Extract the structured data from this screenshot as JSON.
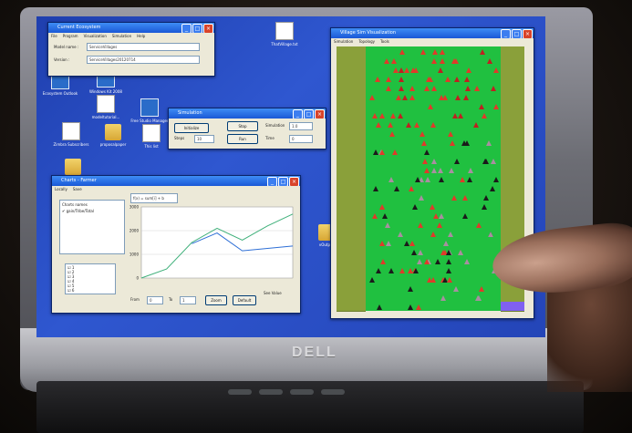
{
  "desktop": {
    "icons": [
      {
        "label": "Ecosystem\nOutlook",
        "kind": "app"
      },
      {
        "label": "Windows\nKit 2008",
        "kind": "app"
      },
      {
        "label": "modeltutorial...",
        "kind": "doc"
      },
      {
        "label": "Free Studio\nManager",
        "kind": "app"
      },
      {
        "label": "Zimbra\nSubscribers",
        "kind": "doc"
      },
      {
        "label": "proposalpaper",
        "kind": "folder"
      },
      {
        "label": "This list",
        "kind": "doc"
      },
      {
        "label": "Ecosystem",
        "kind": "folder"
      },
      {
        "label": "vOutput",
        "kind": "folder"
      },
      {
        "label": "ThatVillage.txt",
        "kind": "doc"
      }
    ]
  },
  "model_window": {
    "title": "Current Ecosystem",
    "menu": [
      "File",
      "Program",
      "Visualization",
      "Simulation",
      "Help"
    ],
    "fields": [
      {
        "label": "Model name :",
        "value": "ServiceVillages"
      },
      {
        "label": "Version :",
        "value": "ServiceVillages20120714"
      }
    ]
  },
  "simulation_window": {
    "title": "Simulation",
    "buttons": {
      "initialize": "Initialize",
      "stop": "Stop",
      "run": "Run"
    },
    "fields": [
      {
        "label": "Steps",
        "value": "10"
      },
      {
        "label": "Simulation",
        "value": "1.0"
      },
      {
        "label": "Time",
        "value": "0"
      }
    ]
  },
  "charts_window": {
    "title": "Charts - Farmer",
    "menu": [
      "Locally",
      "Save"
    ],
    "formula": "f(x) = sum[i] + b",
    "charts_label": "Charts names",
    "chart_item": "gain/Tribe/Total",
    "checks": [
      "1",
      "2",
      "3",
      "4",
      "5",
      "6"
    ],
    "yticks": [
      "3000",
      "2000",
      "1000",
      "0"
    ],
    "from_label": "From",
    "from_value": "0",
    "to_label": "To",
    "to_value": "1",
    "zoom_button": "Zoom",
    "default_button": "Default",
    "see_value": "See Value"
  },
  "chart_data": {
    "type": "line",
    "ylim": [
      0,
      3000
    ],
    "x": [
      0,
      1,
      2,
      3,
      4,
      5,
      6
    ],
    "series": [
      {
        "color": "#3fb07a",
        "values": [
          0,
          380,
          1500,
          2100,
          1600,
          2200,
          2700
        ]
      },
      {
        "color": "#2e6fd6",
        "values": [
          null,
          null,
          1450,
          1900,
          1150,
          1250,
          1350
        ]
      }
    ]
  },
  "grid_window": {
    "title": "Village Sim Visualization",
    "menu": [
      "Simulation",
      "Topology",
      "Tools"
    ],
    "colors": {
      "field": "#20c040",
      "border": "#8aa03a",
      "accent": "#8060f0"
    },
    "palette": [
      "#e03a2a",
      "#1a1a1a",
      "#a88fa0",
      "#c02020"
    ]
  },
  "laptop": {
    "brand": "DELL"
  }
}
